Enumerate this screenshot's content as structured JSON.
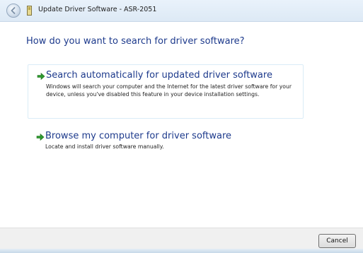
{
  "window": {
    "title": "Update Driver Software - ASR-2051"
  },
  "main": {
    "heading": "How do you want to search for driver software?",
    "options": [
      {
        "title": "Search automatically for updated driver software",
        "description": "Windows will search your computer and the Internet for the latest driver software for your device, unless you've disabled this feature in your device installation settings.",
        "icon": "green-arrow-icon"
      },
      {
        "title": "Browse my computer for driver software",
        "description": "Locate and install driver software manually.",
        "icon": "green-arrow-icon"
      }
    ]
  },
  "footer": {
    "cancel_label": "Cancel"
  },
  "colors": {
    "link_blue": "#1d3a8c",
    "arrow_green": "#2f9a2f",
    "option_border": "#daecf7",
    "footer_bg": "#f0f0f0"
  }
}
